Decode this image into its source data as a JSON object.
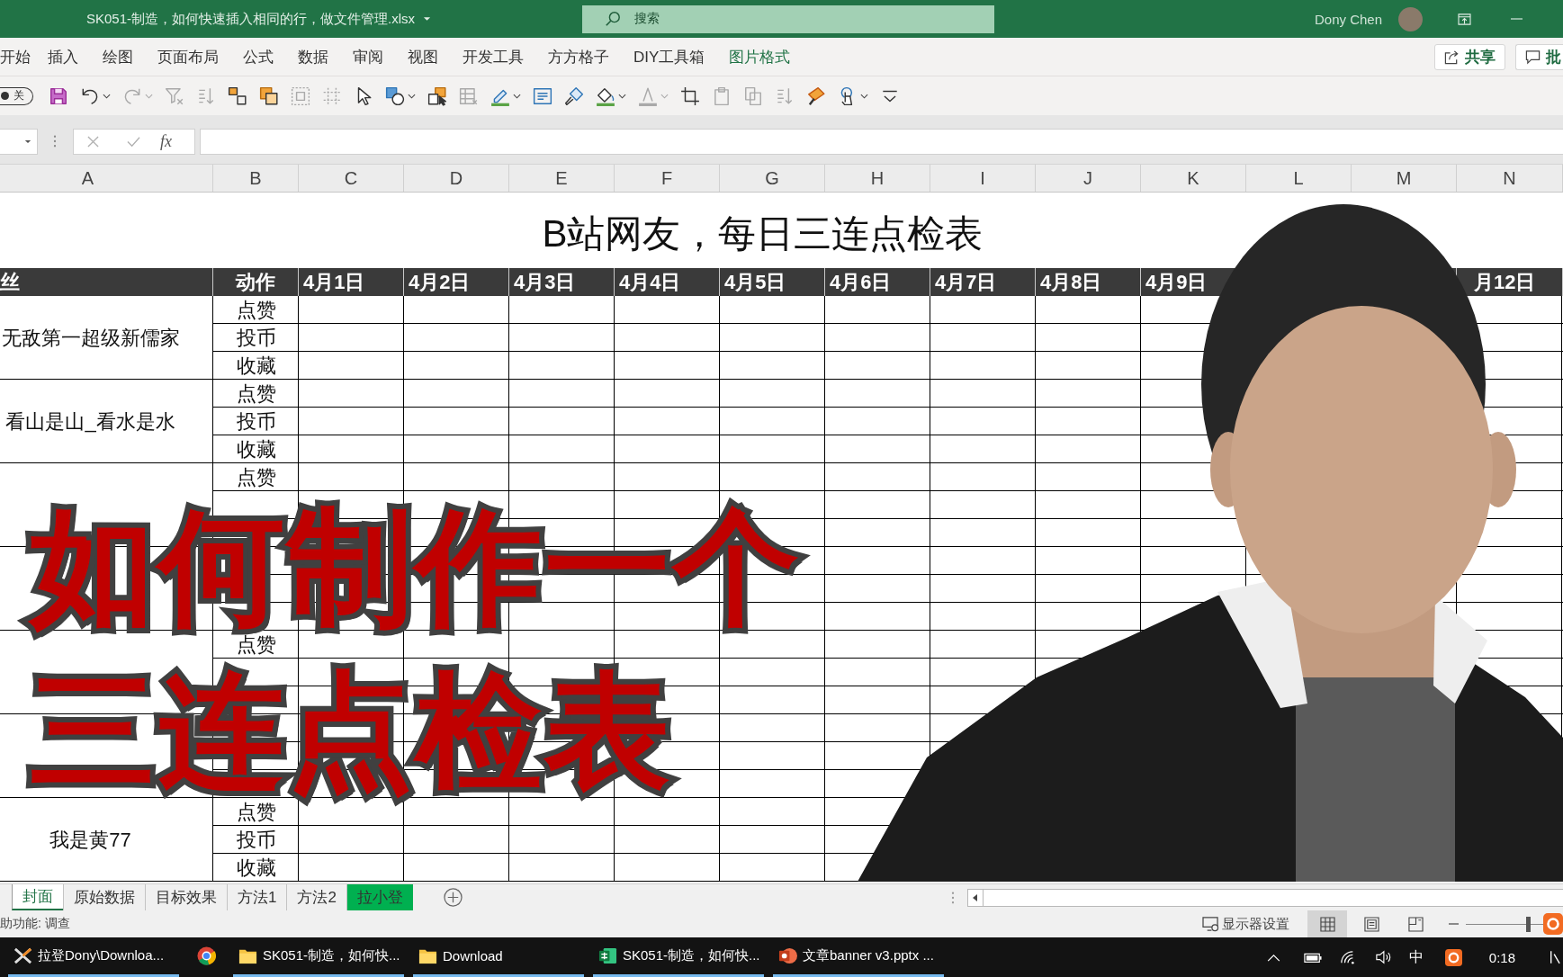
{
  "title_bar": {
    "file_name": "SK051-制造，如何快速插入相同的行，做文件管理.xlsx",
    "search": {
      "placeholder": "搜索"
    },
    "user_name": "Dony Chen"
  },
  "ribbon": {
    "tabs": [
      {
        "label": "开始",
        "selected": false
      },
      {
        "label": "插入",
        "selected": false
      },
      {
        "label": "绘图",
        "selected": false
      },
      {
        "label": "页面布局",
        "selected": false
      },
      {
        "label": "公式",
        "selected": false
      },
      {
        "label": "数据",
        "selected": false
      },
      {
        "label": "审阅",
        "selected": false
      },
      {
        "label": "视图",
        "selected": false
      },
      {
        "label": "开发工具",
        "selected": false
      },
      {
        "label": "方方格子",
        "selected": false
      },
      {
        "label": "DIY工具箱",
        "selected": false
      },
      {
        "label": "图片格式",
        "selected": true
      }
    ],
    "share_button": "共享",
    "comments_button": "批"
  },
  "quick_access": {
    "autosave": {
      "label": "关",
      "on": false
    },
    "tools": [
      {
        "disabled": false
      },
      {
        "disabled": false
      },
      {
        "disabled": true
      },
      {
        "disabled": true
      },
      {
        "disabled": true
      },
      {
        "disabled": false
      },
      {
        "disabled": false
      },
      {
        "disabled": true
      },
      {
        "disabled": true
      },
      {
        "disabled": false
      },
      {
        "disabled": false
      },
      {
        "disabled": false
      },
      {
        "disabled": true
      },
      {
        "disabled": false
      },
      {
        "disabled": false
      },
      {
        "disabled": false
      },
      {
        "disabled": false
      },
      {
        "disabled": true
      },
      {
        "disabled": false
      },
      {
        "disabled": true
      },
      {
        "disabled": true
      },
      {
        "disabled": true
      },
      {
        "disabled": false
      },
      {
        "disabled": false
      },
      {
        "disabled": false
      }
    ]
  },
  "formula_bar": {
    "function_button": "fx"
  },
  "sheet": {
    "columns": [
      "A",
      "B",
      "C",
      "D",
      "E",
      "F",
      "G",
      "H",
      "I",
      "J",
      "K",
      "L",
      "M",
      "N"
    ],
    "title": "B站网友，每日三连点检表",
    "header": [
      "丝",
      "动作",
      "4月1日",
      "4月2日",
      "4月3日",
      "4月4日",
      "4月5日",
      "4月6日",
      "4月7日",
      "4月8日",
      "4月9日"
    ],
    "header_last": "月12日",
    "groups": [
      {
        "name": "无敌第一超级新儒家",
        "actions": [
          "点赞",
          "投币",
          "收藏"
        ]
      },
      {
        "name": "看山是山_看水是水",
        "actions": [
          "点赞",
          "投币",
          "收藏"
        ]
      },
      {
        "actions": [
          "点赞"
        ]
      },
      {
        "actions": [
          "点赞"
        ]
      },
      {
        "name": "我是黄77",
        "actions": [
          "点赞",
          "投币",
          "收藏"
        ]
      }
    ]
  },
  "overlay_title": [
    "如何制作一个",
    "三连点检表"
  ],
  "sheet_tabs": [
    {
      "label": "封面",
      "selected": true
    },
    {
      "label": "原始数据",
      "selected": false
    },
    {
      "label": "目标效果",
      "selected": false
    },
    {
      "label": "方法1",
      "selected": false
    },
    {
      "label": "方法2",
      "selected": false
    },
    {
      "label": "拉小登",
      "selected": false,
      "color": "#00b050"
    }
  ],
  "status_bar": {
    "accessibility": "助功能: 调查",
    "display_settings": "显示器设置",
    "views": [
      {
        "selected": true
      },
      {
        "selected": false
      },
      {
        "selected": false
      }
    ],
    "zoom": {
      "level": 0.8
    }
  },
  "taskbar": {
    "items": [
      {
        "label": "拉登Dony\\Downloa...",
        "running": true
      },
      {
        "running": false
      },
      {
        "label": "SK051-制造，如何快...",
        "running": true
      },
      {
        "label": "Download",
        "running": true
      },
      {
        "label": "SK051-制造，如何快...",
        "running": true
      },
      {
        "label": "文章banner v3.pptx ...",
        "running": true
      }
    ],
    "ime": "中",
    "time": "0:18"
  }
}
